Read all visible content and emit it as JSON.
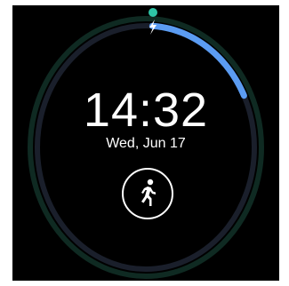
{
  "watch_face": {
    "time": "14:32",
    "date": "Wed, Jun 17",
    "battery_level": 0.18,
    "colors": {
      "background": "#000000",
      "text": "#ffffff",
      "battery_arc": "#5b9cf2",
      "outer_ring": "#0f2a22",
      "inner_ring": "#1a1f2b",
      "indicator_dot": "#2ec4a6"
    },
    "icons": {
      "charging": "lightning-bolt-icon",
      "activity": "running-person-icon"
    }
  }
}
